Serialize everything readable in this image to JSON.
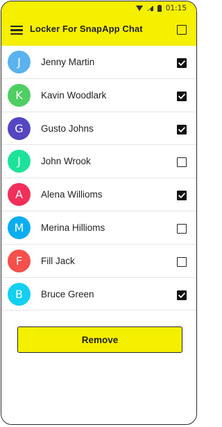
{
  "status_bar": {
    "time": "01:15",
    "icons": [
      "wifi-icon",
      "signal-icon",
      "battery-icon"
    ]
  },
  "app_bar": {
    "title": "Locker For SnapApp Chat",
    "menu_icon": "hamburger-menu-icon",
    "select_all_checked": false
  },
  "contacts": [
    {
      "initial": "J",
      "name": "Jenny Martin",
      "color": "#5ab2ee",
      "checked": true
    },
    {
      "initial": "K",
      "name": "Kavin Woodlark",
      "color": "#4fce63",
      "checked": true
    },
    {
      "initial": "G",
      "name": "Gusto Johns",
      "color": "#5346c1",
      "checked": true
    },
    {
      "initial": "J",
      "name": "John Wrook",
      "color": "#1de39a",
      "checked": false
    },
    {
      "initial": "A",
      "name": "Alena Willioms",
      "color": "#f12f5a",
      "checked": true
    },
    {
      "initial": "M",
      "name": "Merina Hillioms",
      "color": "#0aaef0",
      "checked": false
    },
    {
      "initial": "F",
      "name": "Fill Jack",
      "color": "#f4504c",
      "checked": false
    },
    {
      "initial": "B",
      "name": "Bruce Green",
      "color": "#13cff0",
      "checked": true
    }
  ],
  "actions": {
    "remove_label": "Remove"
  },
  "colors": {
    "accent": "#f5ef00"
  }
}
